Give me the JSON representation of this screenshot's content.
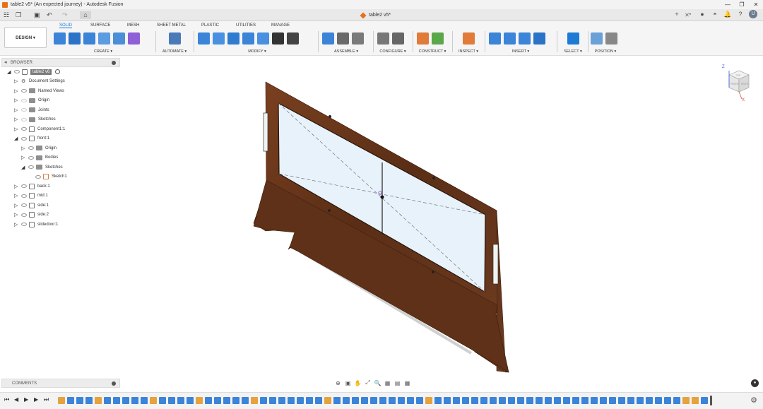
{
  "window": {
    "title": "table2 v5* (An expected journey) - Autodesk Fusion",
    "controls": [
      "—",
      "❐",
      "✕"
    ]
  },
  "quick_access": {
    "grid_icon": "☷",
    "file_icon": "❐",
    "save_icon": "▣",
    "undo_icon": "↶",
    "redo_icon": "↷",
    "home_icon": "⌂"
  },
  "document_tab": {
    "name": "table2 v5*",
    "close": "✕"
  },
  "right_toolbar": {
    "icons": [
      "+",
      "◔",
      "●",
      "◓",
      "🔔",
      "?"
    ],
    "avatar": "U"
  },
  "ribbon": {
    "design_label": "DESIGN ▾",
    "tabs": [
      "SOLID",
      "SURFACE",
      "MESH",
      "SHEET METAL",
      "PLASTIC",
      "UTILITIES",
      "MANAGE"
    ],
    "active_tab": "SOLID",
    "groups": [
      {
        "label": "CREATE ▾",
        "colors": [
          "#3b84d8",
          "#2b73c7",
          "#3b84d8",
          "#5b9bdf",
          "#4b8fd7",
          "#8e5fd6"
        ]
      },
      {
        "label": "AUTOMATE ▾",
        "colors": [
          "#4b7ab8"
        ]
      },
      {
        "label": "MODIFY ▾",
        "colors": [
          "#3b84d8",
          "#4a90e0",
          "#2f7bd0",
          "#3b84d8",
          "#4a90e0",
          "#333333",
          "#444444"
        ]
      },
      {
        "label": "ASSEMBLE ▾",
        "colors": [
          "#3b84d8",
          "#6a6a6a",
          "#7a7a7a"
        ]
      },
      {
        "label": "CONFIGURE ▾",
        "colors": [
          "#777777",
          "#666666"
        ]
      },
      {
        "label": "CONSTRUCT ▾",
        "colors": [
          "#e07b39",
          "#5aa84a"
        ]
      },
      {
        "label": "INSPECT ▾",
        "colors": [
          "#e07b39"
        ]
      },
      {
        "label": "INSERT ▾",
        "colors": [
          "#3b84d8",
          "#3b84d8",
          "#3b84d8",
          "#2b73c7"
        ]
      },
      {
        "label": "SELECT ▾",
        "colors": [
          "#1d7bd6"
        ]
      },
      {
        "label": "POSITION ▾",
        "colors": [
          "#6aa0d8",
          "#888888"
        ]
      }
    ]
  },
  "browser": {
    "header": "BROWSER",
    "items": [
      {
        "label": "table2 v6",
        "indent": 0,
        "expand": "◢",
        "kind": "root"
      },
      {
        "label": "Document Settings",
        "indent": 1,
        "expand": "▷",
        "kind": "settings"
      },
      {
        "label": "Named Views",
        "indent": 1,
        "expand": "▷",
        "kind": "folder"
      },
      {
        "label": "Origin",
        "indent": 1,
        "expand": "▷",
        "kind": "folder"
      },
      {
        "label": "Joints",
        "indent": 1,
        "expand": "▷",
        "kind": "folder"
      },
      {
        "label": "Sketches",
        "indent": 1,
        "expand": "▷",
        "kind": "folder"
      },
      {
        "label": "Component1:1",
        "indent": 1,
        "expand": "▷",
        "kind": "component"
      },
      {
        "label": "front:1",
        "indent": 1,
        "expand": "◢",
        "kind": "component"
      },
      {
        "label": "Origin",
        "indent": 2,
        "expand": "▷",
        "kind": "folder"
      },
      {
        "label": "Bodies",
        "indent": 2,
        "expand": "▷",
        "kind": "folder"
      },
      {
        "label": "Sketches",
        "indent": 2,
        "expand": "◢",
        "kind": "folder"
      },
      {
        "label": "Sketch1",
        "indent": 3,
        "expand": "",
        "kind": "sketch"
      },
      {
        "label": "back:1",
        "indent": 1,
        "expand": "▷",
        "kind": "component"
      },
      {
        "label": "mid:1",
        "indent": 1,
        "expand": "▷",
        "kind": "component"
      },
      {
        "label": "side:1",
        "indent": 1,
        "expand": "▷",
        "kind": "component"
      },
      {
        "label": "side:2",
        "indent": 1,
        "expand": "▷",
        "kind": "component"
      },
      {
        "label": "slidedoor:1",
        "indent": 1,
        "expand": "▷",
        "kind": "component"
      }
    ]
  },
  "comments": {
    "header": "COMMENTS"
  },
  "viewcube": {
    "faces": [
      "TOP",
      "FRONT",
      "RIGHT"
    ],
    "axes": [
      "Z",
      "X"
    ]
  },
  "nav_bar": {
    "icons": [
      "⊕",
      "▣",
      "✋",
      "⤢",
      "🔍",
      "▦",
      "▤",
      "▦"
    ]
  },
  "timeline": {
    "controls": [
      "⏮",
      "◀",
      "▶",
      "▶",
      "⏭"
    ],
    "item_colors": [
      "#e6a23c",
      "#3b84d8",
      "#3b84d8",
      "#3b84d8",
      "#e6a23c",
      "#3b84d8",
      "#3b84d8",
      "#3b84d8",
      "#3b84d8",
      "#3b84d8",
      "#e6a23c",
      "#3b84d8",
      "#3b84d8",
      "#3b84d8",
      "#3b84d8",
      "#e6a23c",
      "#3b84d8",
      "#3b84d8",
      "#3b84d8",
      "#3b84d8",
      "#3b84d8",
      "#e6a23c",
      "#3b84d8",
      "#3b84d8",
      "#3b84d8",
      "#3b84d8",
      "#3b84d8",
      "#3b84d8",
      "#3b84d8",
      "#e6a23c",
      "#3b84d8",
      "#3b84d8",
      "#3b84d8",
      "#3b84d8",
      "#3b84d8",
      "#3b84d8",
      "#3b84d8",
      "#3b84d8",
      "#3b84d8",
      "#3b84d8",
      "#e6a23c",
      "#3b84d8",
      "#3b84d8",
      "#3b84d8",
      "#3b84d8",
      "#3b84d8",
      "#3b84d8",
      "#3b84d8",
      "#3b84d8",
      "#3b84d8",
      "#3b84d8",
      "#3b84d8",
      "#3b84d8",
      "#3b84d8",
      "#3b84d8",
      "#3b84d8",
      "#3b84d8",
      "#3b84d8",
      "#3b84d8",
      "#3b84d8",
      "#3b84d8",
      "#3b84d8",
      "#3b84d8",
      "#3b84d8",
      "#3b84d8",
      "#3b84d8",
      "#3b84d8",
      "#3b84d8",
      "#e6a23c",
      "#e6a23c",
      "#3b84d8",
      "#3b84d8",
      "#3b84d8",
      "#3b84d8",
      "#3b84d8",
      "#3b84d8",
      "#3b84d8",
      "#3b84d8",
      "#3b84d8",
      "#e6a23c"
    ],
    "settings_icon": "⚙"
  },
  "colors": {
    "accent": "#1d7bd6",
    "wood": "#6b3a1f",
    "glass": "#e6f1fa"
  }
}
